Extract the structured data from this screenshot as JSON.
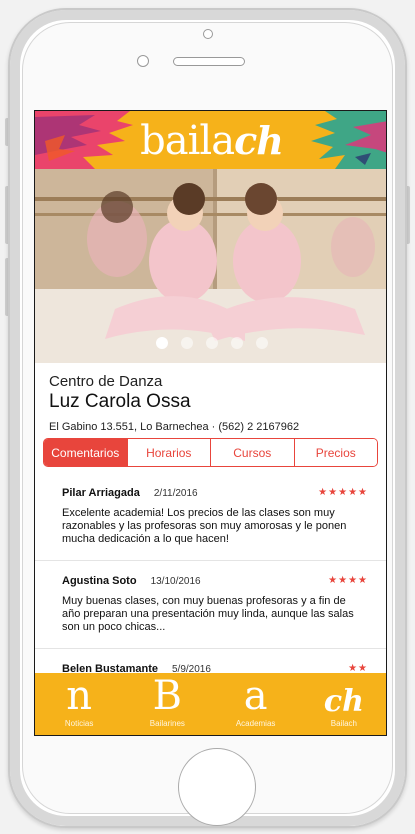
{
  "app": {
    "logo_text": "baila",
    "logo_mark": "ch",
    "brand_color": "#f6b21a",
    "accent_color": "#e8453c"
  },
  "hero": {
    "slide_count": 5,
    "active_slide": 1
  },
  "academy": {
    "subtitle": "Centro de Danza",
    "name": "Luz Carola Ossa",
    "address": "El Gabino 13.551, Lo Barnechea  ·  (562) 2 2167962"
  },
  "tabs": [
    {
      "label": "Comentarios",
      "active": true
    },
    {
      "label": "Horarios",
      "active": false
    },
    {
      "label": "Cursos",
      "active": false
    },
    {
      "label": "Precios",
      "active": false
    }
  ],
  "comments": [
    {
      "name": "Pilar Arriagada",
      "date": "2/11/2016",
      "stars": "★★★★★",
      "rating": 5,
      "text": "Excelente academia! Los precios de las clases son muy razonables y las profesoras son muy amorosas y le ponen mucha dedicación a lo que hacen!"
    },
    {
      "name": "Agustina Soto",
      "date": "13/10/2016",
      "stars": "★★★★",
      "rating": 4,
      "text": "Muy buenas clases, con muy buenas profesoras y a fin de año preparan una presentación muy linda, aunque las salas son un poco chicas..."
    },
    {
      "name": "Belen Bustamante",
      "date": "5/9/2016",
      "stars": "★★",
      "rating": 2,
      "text": ""
    }
  ],
  "nav": [
    {
      "glyph": "n",
      "label": "Noticias"
    },
    {
      "glyph": "B",
      "label": "Bailarines"
    },
    {
      "glyph": "a",
      "label": "Academias"
    },
    {
      "glyph": "ch",
      "label": "Bailach"
    }
  ]
}
